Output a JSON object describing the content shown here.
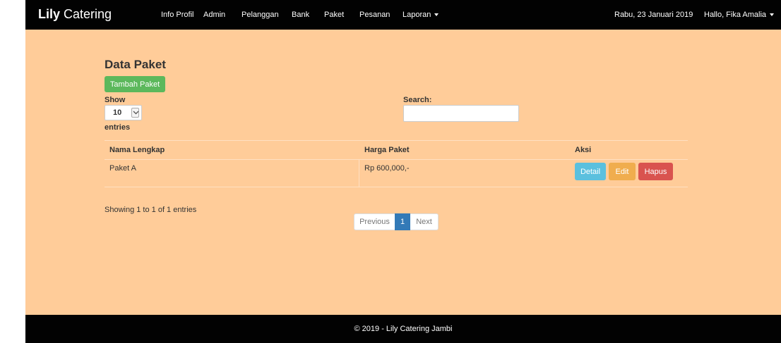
{
  "navbar": {
    "brand_bold": "Lily",
    "brand_rest": " Catering",
    "items": [
      "Info Profil",
      "Admin",
      "Pelanggan",
      "Bank",
      "Paket",
      "Pesanan",
      "Laporan"
    ],
    "date": "Rabu, 23 Januari 2019",
    "user": "Hallo, Fika Amalia"
  },
  "main": {
    "title": "Data Paket",
    "add_button": "Tambah Paket",
    "show_label": "Show",
    "page_size": "10",
    "entries_label": "entries",
    "search_label": "Search:",
    "search_value": ""
  },
  "table": {
    "columns": [
      "Nama Lengkap",
      "Harga Paket",
      "Aksi"
    ],
    "rows": [
      {
        "nama": "Paket A",
        "harga": "Rp 600,000,-"
      }
    ],
    "actions": {
      "detail": "Detail",
      "edit": "Edit",
      "hapus": "Hapus"
    }
  },
  "pagination": {
    "info": "Showing 1 to 1 of 1 entries",
    "previous": "Previous",
    "current": "1",
    "next": "Next"
  },
  "footer": {
    "text": "© 2019 - Lily Catering Jambi"
  },
  "colors": {
    "navbar_bg": "#020202",
    "content_bg": "#ffcc99",
    "success": "#5cb85c",
    "info": "#5bc0de",
    "warning": "#f0ad4e",
    "danger": "#d9534f",
    "primary": "#337ab7"
  }
}
